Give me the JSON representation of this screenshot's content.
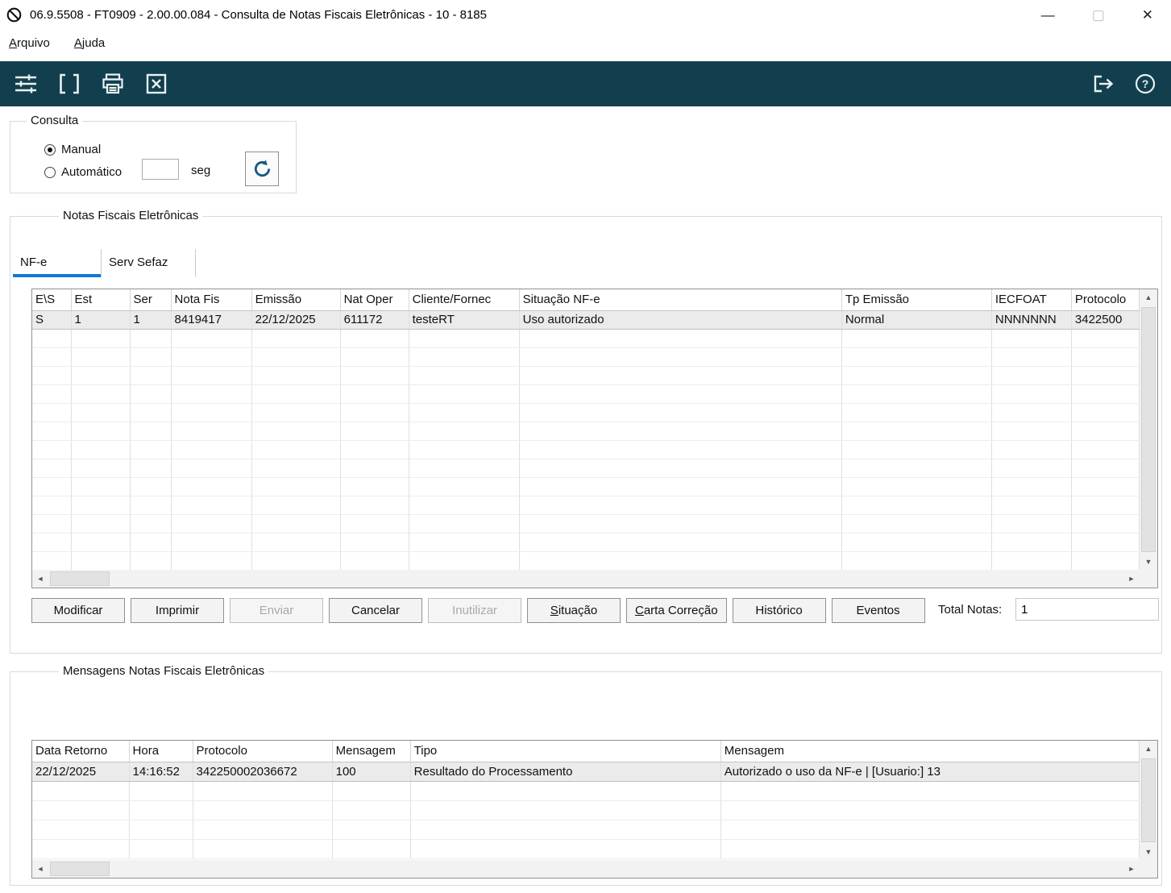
{
  "colors": {
    "toolbar_bg": "#123f4d",
    "tab_accent": "#0e7ad6",
    "selected_row": "#ebebeb",
    "refresh_icon": "#1a5a82"
  },
  "window": {
    "title": "06.9.5508 - FT0909 - 2.00.00.084 - Consulta de Notas Fiscais Eletrônicas - 10 - 8185",
    "controls": {
      "minimize": "—",
      "maximize": "▢",
      "close": "✕"
    }
  },
  "menu": {
    "items": [
      "Arquivo",
      "Ajuda"
    ]
  },
  "consulta": {
    "legend": "Consulta",
    "options": [
      {
        "label": "Manual",
        "selected": true
      },
      {
        "label": "Automático",
        "selected": false
      }
    ],
    "interval_value": "",
    "interval_unit": "seg"
  },
  "nfe_group": {
    "legend": "Notas Fiscais Eletrônicas",
    "tabs": [
      {
        "label": "NF-e",
        "active": true
      },
      {
        "label": "Serv Sefaz",
        "active": false
      }
    ],
    "table": {
      "columns": [
        "E\\S",
        "Est",
        "Ser",
        "Nota Fis",
        "Emissão",
        "Nat Oper",
        "Cliente/Fornec",
        "Situação NF-e",
        "Tp Emissão",
        "IECFOAT",
        "Protocolo"
      ],
      "rows": [
        [
          "S",
          "1",
          "1",
          "8419417",
          "22/12/2025",
          "611172",
          "testeRT",
          "Uso autorizado",
          "Normal",
          "NNNNNNN",
          "3422500"
        ]
      ]
    },
    "buttons": [
      {
        "name": "modificar-button",
        "label": "Modificar",
        "enabled": true,
        "underline_first": false
      },
      {
        "name": "imprimir-button",
        "label": "Imprimir",
        "enabled": true,
        "underline_first": false
      },
      {
        "name": "enviar-button",
        "label": "Enviar",
        "enabled": false,
        "underline_first": false
      },
      {
        "name": "cancelar-button",
        "label": "Cancelar",
        "enabled": true,
        "underline_first": false
      },
      {
        "name": "inutilizar-button",
        "label": "Inutilizar",
        "enabled": false,
        "underline_first": false
      },
      {
        "name": "situacao-button",
        "label": "Situação",
        "enabled": true,
        "underline_first": true
      },
      {
        "name": "carta-correcao-button",
        "label": "Carta Correção",
        "enabled": true,
        "underline_first": true
      },
      {
        "name": "historico-button",
        "label": "Histórico",
        "enabled": true,
        "underline_first": false
      },
      {
        "name": "eventos-button",
        "label": "Eventos",
        "enabled": true,
        "underline_first": false
      }
    ],
    "total_label": "Total Notas:",
    "total_value": "1"
  },
  "mensagens_group": {
    "legend": "Mensagens Notas Fiscais Eletrônicas",
    "table": {
      "columns": [
        "Data Retorno",
        "Hora",
        "Protocolo",
        "Mensagem",
        "Tipo",
        "Mensagem"
      ],
      "rows": [
        [
          "22/12/2025",
          "14:16:52",
          "342250002036672",
          "100",
          "Resultado do Processamento",
          "Autorizado o uso da NF-e | [Usuario:] 13"
        ]
      ]
    }
  },
  "icons": {
    "up": "▲",
    "down": "▼",
    "left": "◄",
    "right": "►"
  }
}
